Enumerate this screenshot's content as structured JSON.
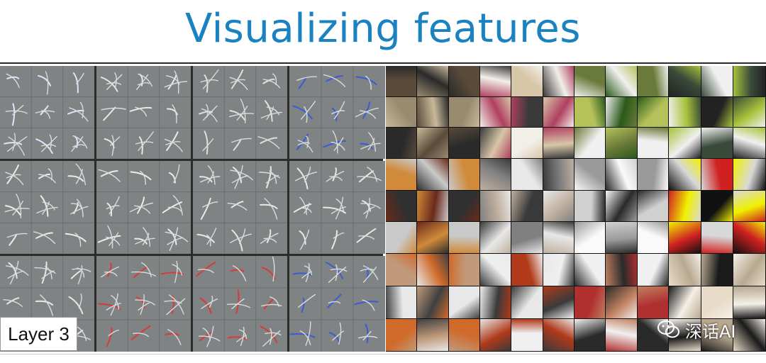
{
  "title": "Visualizing features",
  "layer_label": "Layer 3",
  "watermark": "深话AI",
  "colors": {
    "title": "#1a82c0",
    "panel_gray": "#7f8383",
    "feature_blue": "#3b5bd6",
    "feature_red": "#d83a3a",
    "feature_yellow": "#d6d43a"
  },
  "icons": [
    "wechat-icon"
  ]
}
